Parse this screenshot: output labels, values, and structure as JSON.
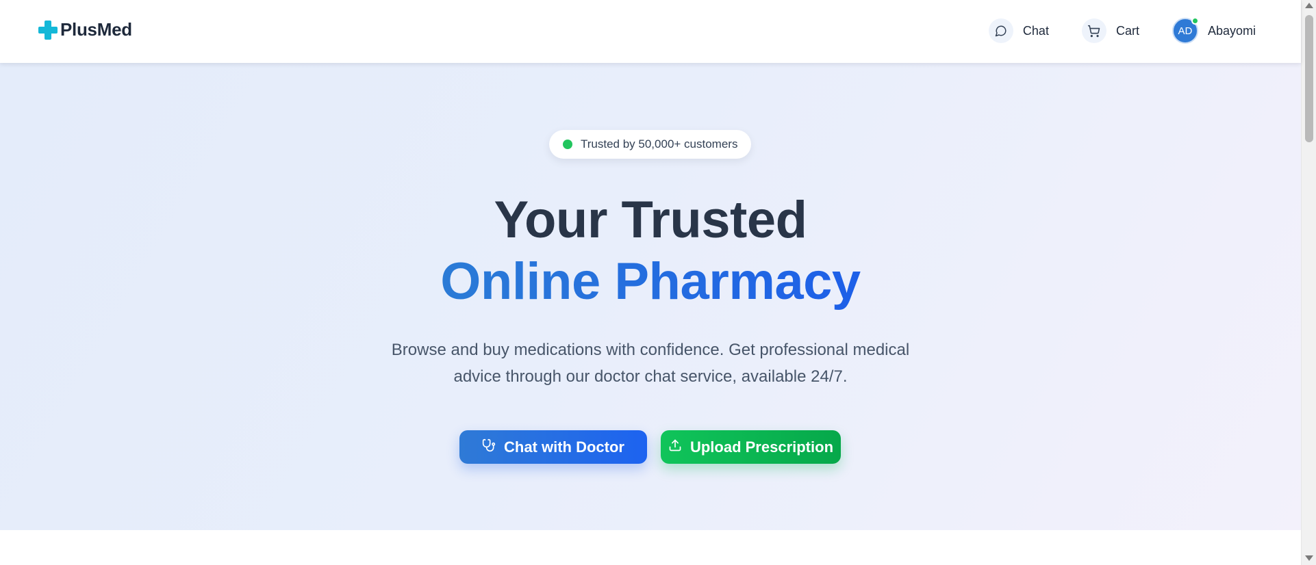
{
  "brand": {
    "name": "PlusMed",
    "icon": "plus-cross-icon",
    "icon_color": "#14b8d8"
  },
  "nav": {
    "chat": {
      "label": "Chat",
      "icon": "chat-bubble-icon"
    },
    "cart": {
      "label": "Cart",
      "icon": "shopping-cart-icon"
    },
    "user": {
      "initials": "AD",
      "name": "Abayomi",
      "status": "online",
      "status_color": "#22c55e"
    }
  },
  "hero": {
    "badge": "Trusted by 50,000+ customers",
    "title_line1": "Your Trusted",
    "title_line2": "Online Pharmacy",
    "subtitle": "Browse and buy medications with confidence. Get professional medical advice through our doctor chat service, available 24/7.",
    "buttons": {
      "chat_doctor": {
        "label": "Chat with Doctor",
        "icon": "stethoscope-icon",
        "color": "#2563eb"
      },
      "upload_prescription": {
        "label": "Upload Prescription",
        "icon": "upload-icon",
        "color": "#10b954"
      }
    }
  },
  "colors": {
    "heading_dark": "#293548",
    "heading_accent": "#2563eb",
    "hero_background": "#e6edfa"
  }
}
